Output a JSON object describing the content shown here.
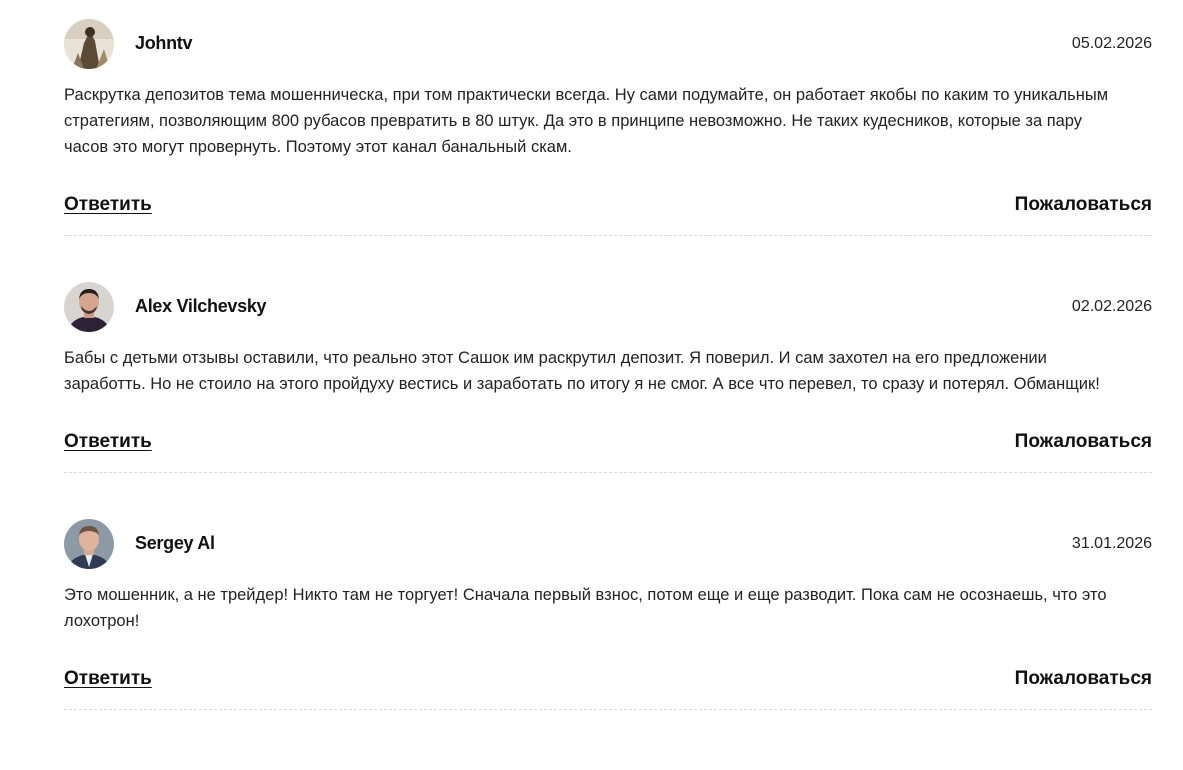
{
  "comments": [
    {
      "author": "Johntv",
      "date": "05.02.2026",
      "avatar_icon": "user-avatar-photo",
      "text": "Раскрутка депозитов тема мошенническа, при том практически всегда. Ну сами подумайте, он работает якобы по каким то уникальным стратегиям, позволяющим 800 рубасов превратить в 80 штук. Да это в принципе невозможно. Не таких кудесников, которые за пару часов это могут провернуть. Поэтому этот канал банальный скам.",
      "reply_label": "Ответить",
      "report_label": "Пожаловаться"
    },
    {
      "author": "Alex Vilchevsky",
      "date": "02.02.2026",
      "avatar_icon": "user-avatar-photo",
      "text": "Бабы с детьми отзывы оставили, что реально этот Сашок им раскрутил депозит. Я поверил. И сам захотел на его предложении заработть. Но не стоило на этого пройдуху вестись и заработать по итогу я не смог. А все что перевел, то сразу и потерял. Обманщик!",
      "reply_label": "Ответить",
      "report_label": "Пожаловаться"
    },
    {
      "author": "Sergey Al",
      "date": "31.01.2026",
      "avatar_icon": "user-avatar-photo",
      "text": "Это мошенник, а не трейдер! Никто там не торгует! Сначала первый взнос, потом еще и еще разводит. Пока сам не осознаешь, что это лохотрон!",
      "reply_label": "Ответить",
      "report_label": "Пожаловаться"
    }
  ]
}
